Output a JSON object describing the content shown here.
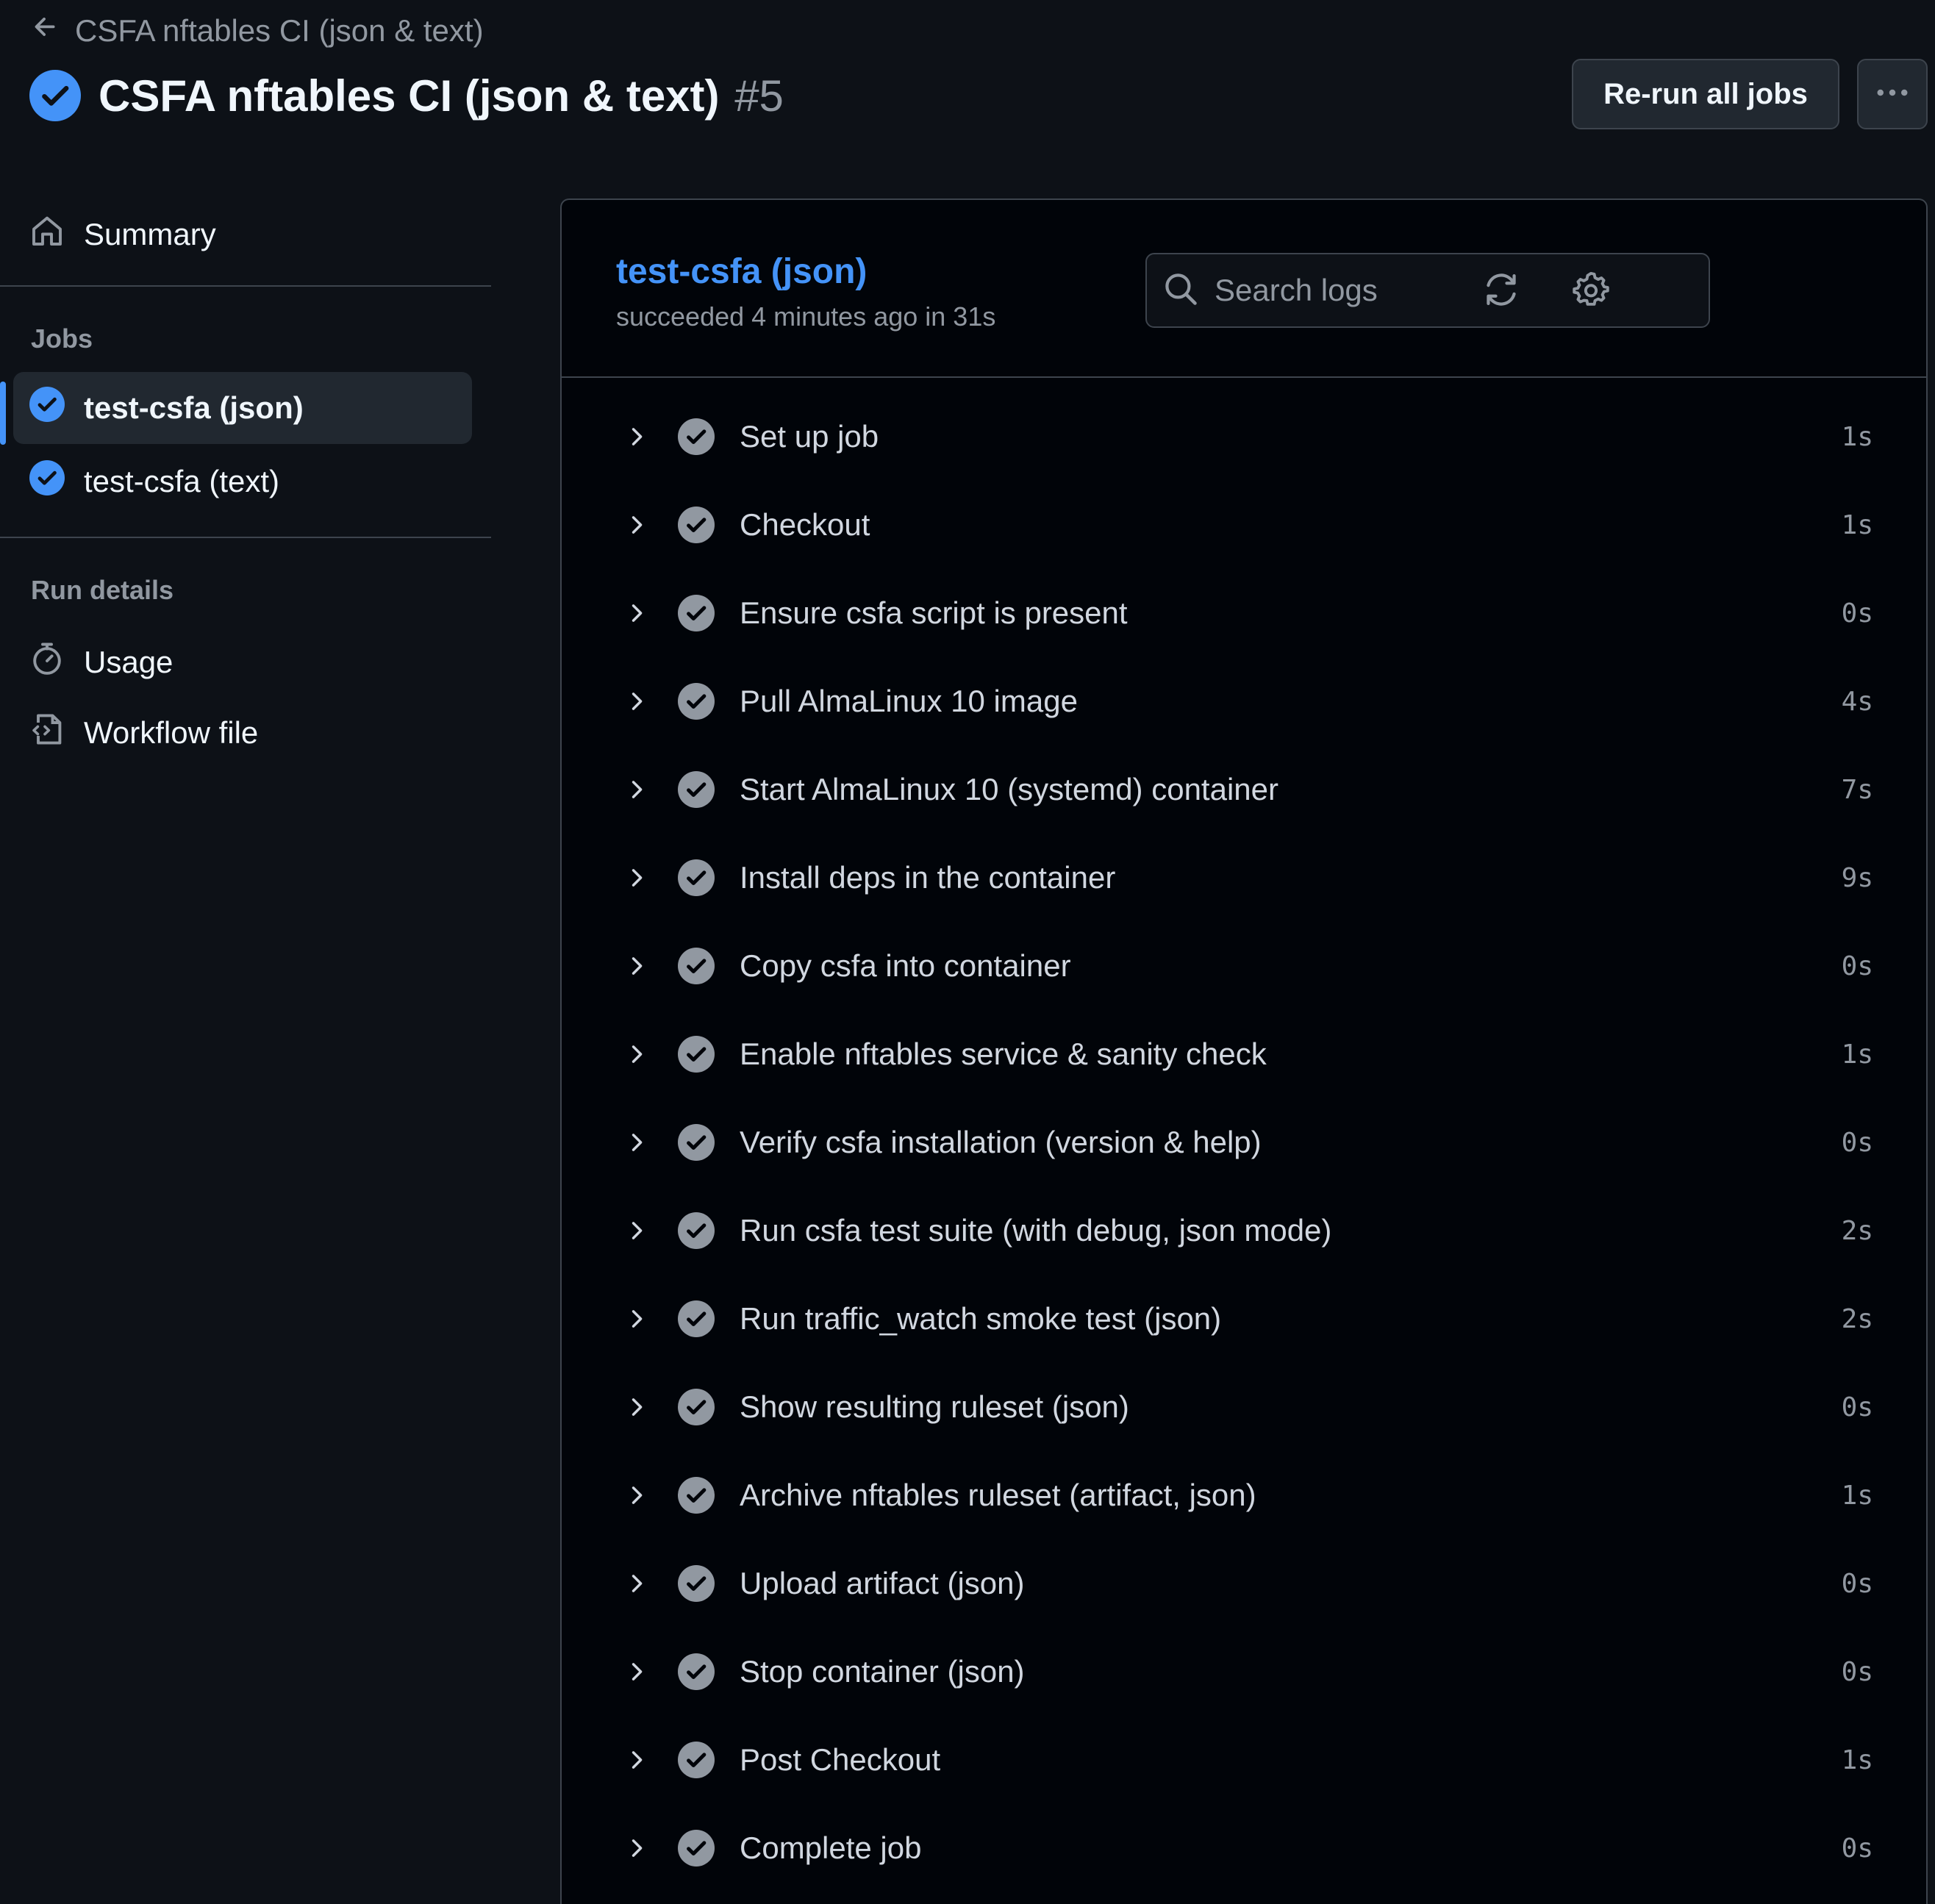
{
  "header": {
    "back_label": "CSFA nftables CI (json & text)",
    "title": "CSFA nftables CI (json & text)",
    "run_number": "#5",
    "rerun_label": "Re-run all jobs"
  },
  "sidebar": {
    "summary_label": "Summary",
    "jobs_heading": "Jobs",
    "jobs": [
      {
        "label": "test-csfa (json)",
        "status": "success",
        "active": true
      },
      {
        "label": "test-csfa (text)",
        "status": "success",
        "active": false
      }
    ],
    "run_details_heading": "Run details",
    "run_details": [
      {
        "label": "Usage",
        "icon": "stopwatch-icon"
      },
      {
        "label": "Workflow file",
        "icon": "file-code-icon"
      }
    ]
  },
  "job": {
    "title": "test-csfa (json)",
    "subtitle": "succeeded 4 minutes ago in 31s",
    "search_placeholder": "Search logs",
    "steps": [
      {
        "name": "Set up job",
        "duration": "1s"
      },
      {
        "name": "Checkout",
        "duration": "1s"
      },
      {
        "name": "Ensure csfa script is present",
        "duration": "0s"
      },
      {
        "name": "Pull AlmaLinux 10 image",
        "duration": "4s"
      },
      {
        "name": "Start AlmaLinux 10 (systemd) container",
        "duration": "7s"
      },
      {
        "name": "Install deps in the container",
        "duration": "9s"
      },
      {
        "name": "Copy csfa into container",
        "duration": "0s"
      },
      {
        "name": "Enable nftables service & sanity check",
        "duration": "1s"
      },
      {
        "name": "Verify csfa installation (version & help)",
        "duration": "0s"
      },
      {
        "name": "Run csfa test suite (with debug, json mode)",
        "duration": "2s"
      },
      {
        "name": "Run traffic_watch smoke test (json)",
        "duration": "2s"
      },
      {
        "name": "Show resulting ruleset (json)",
        "duration": "0s"
      },
      {
        "name": "Archive nftables ruleset (artifact, json)",
        "duration": "1s"
      },
      {
        "name": "Upload artifact (json)",
        "duration": "0s"
      },
      {
        "name": "Stop container (json)",
        "duration": "0s"
      },
      {
        "name": "Post Checkout",
        "duration": "1s"
      },
      {
        "name": "Complete job",
        "duration": "0s"
      }
    ]
  },
  "colors": {
    "background": "#0d1117",
    "panel": "#010409",
    "accent": "#4493f8",
    "success_icon": "#4493f8",
    "step_check": "#9198a1",
    "border": "#3d444d"
  }
}
